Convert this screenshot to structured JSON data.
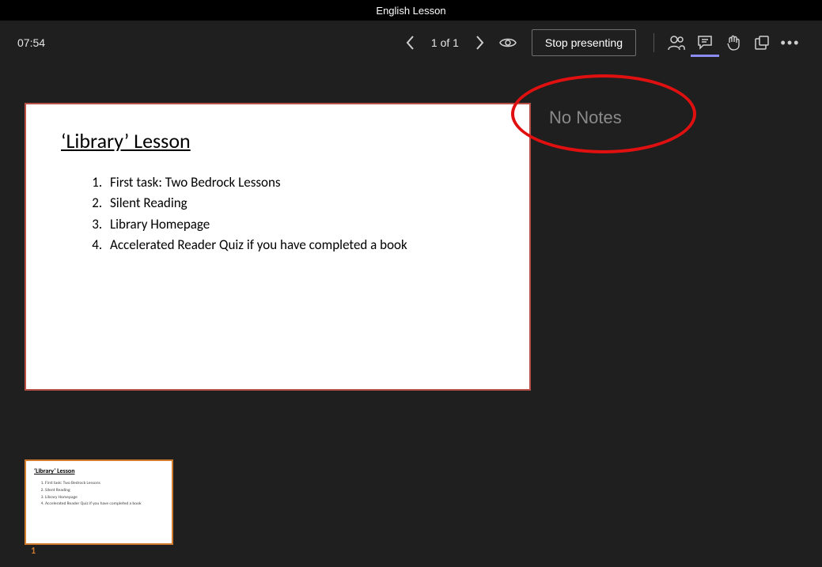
{
  "titlebar": {
    "title": "English Lesson"
  },
  "toolbar": {
    "time": "07:54",
    "page_label": "1 of 1",
    "stop_label": "Stop presenting"
  },
  "slide": {
    "title": "‘Library’ Lesson",
    "items": [
      "First task: Two Bedrock Lessons",
      "Silent Reading",
      "Library Homepage",
      "Accelerated Reader Quiz if you have completed a book"
    ]
  },
  "notes": {
    "placeholder": "No Notes"
  },
  "thumb": {
    "number": "1",
    "title": "‘Library’ Lesson",
    "items": [
      "First task: Two Bedrock Lessons",
      "Silent Reading",
      "Library Homepage",
      "Accelerated Reader Quiz if you have completed a book"
    ]
  }
}
